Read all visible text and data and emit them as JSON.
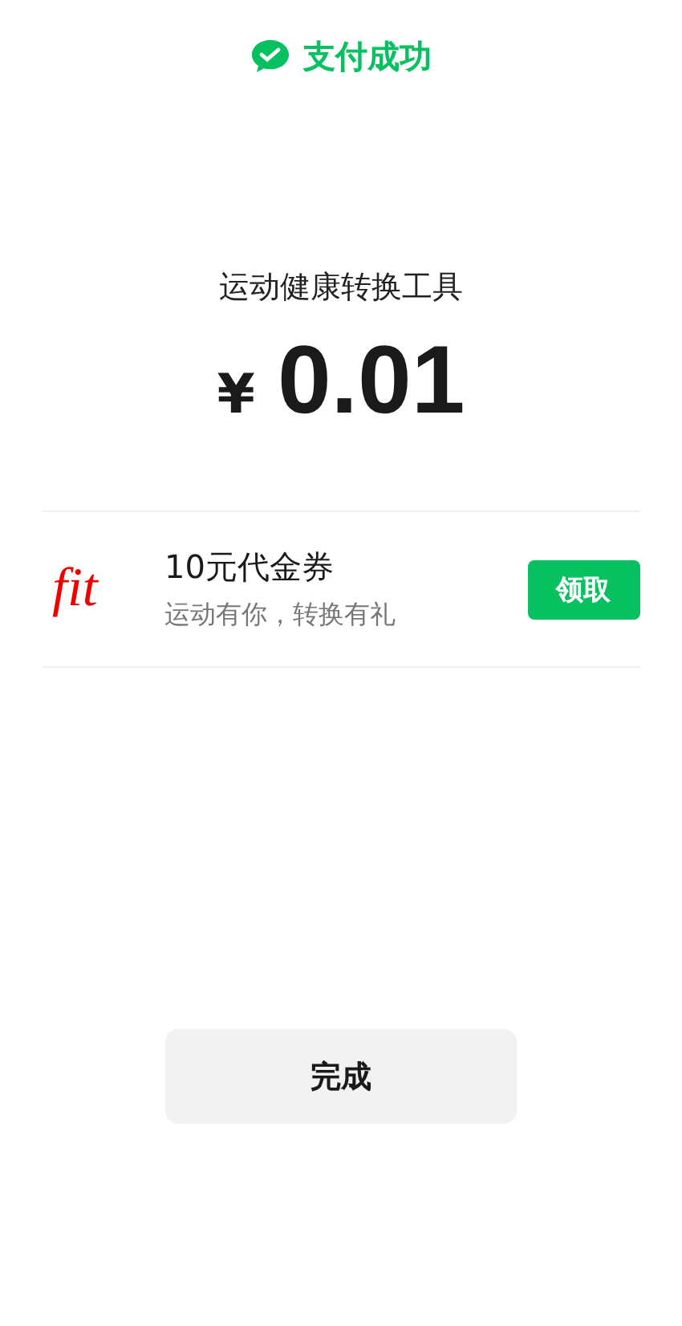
{
  "header": {
    "title": "支付成功"
  },
  "payment": {
    "merchant": "运动健康转换工具",
    "currency": "¥",
    "amount": "0.01"
  },
  "coupon": {
    "logo": "fit",
    "title": "10元代金券",
    "subtitle": "运动有你，转换有礼",
    "button": "领取"
  },
  "done_button": "完成"
}
